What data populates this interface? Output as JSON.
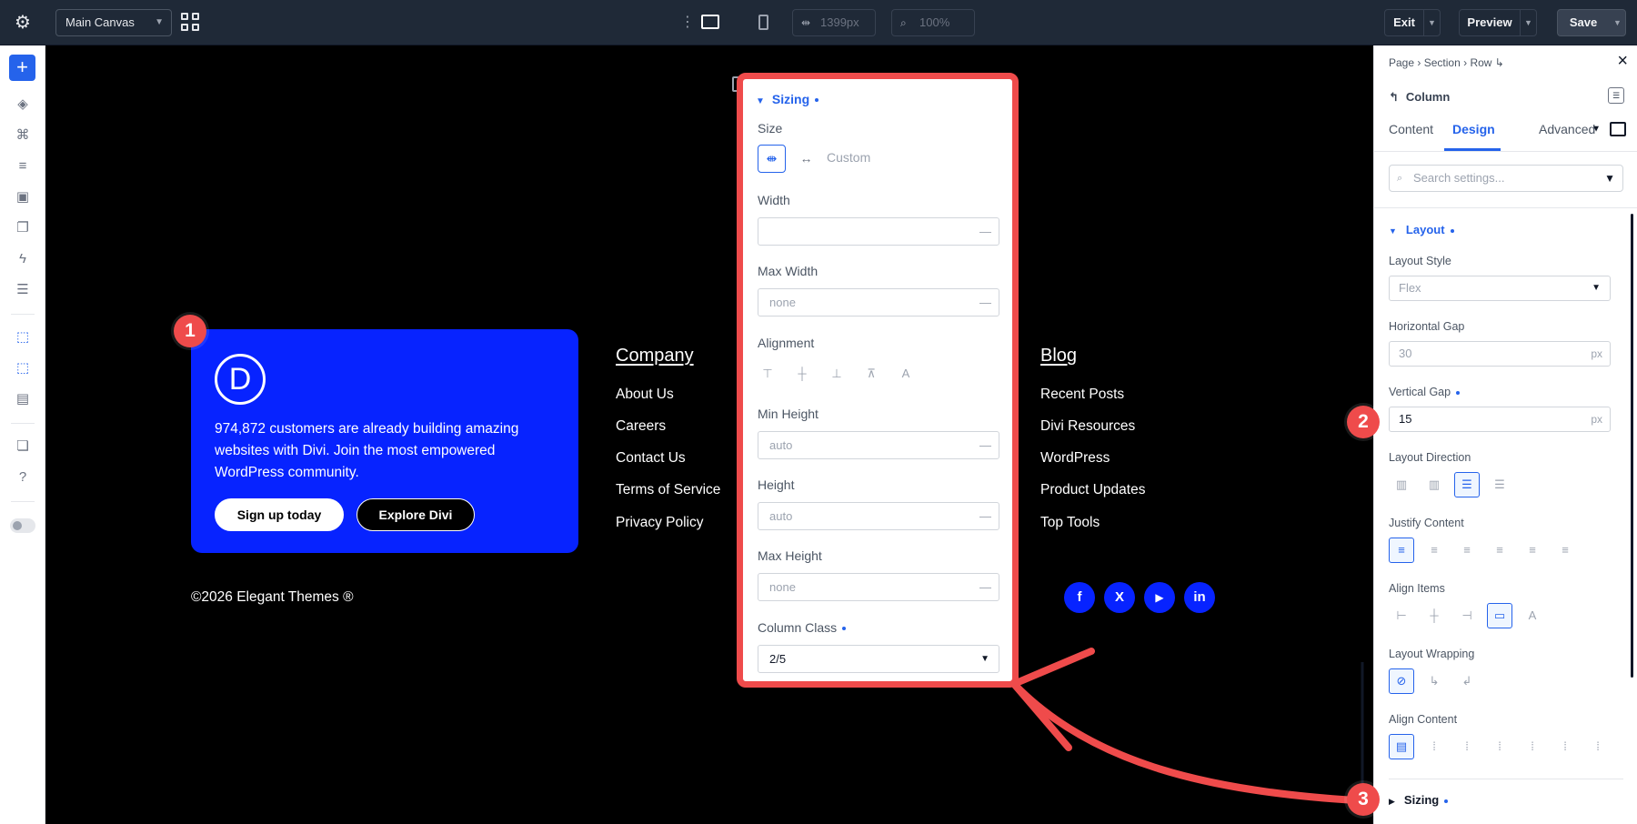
{
  "topbar": {
    "canvas_select": "Main Canvas",
    "width_value": "1399px",
    "zoom_value": "100%",
    "exit_label": "Exit",
    "preview_label": "Preview",
    "save_label": "Save"
  },
  "promo": {
    "logo_letter": "D",
    "text": "974,872 customers are already building amazing websites with Divi. Join the most empowered WordPress community.",
    "signup_label": "Sign up today",
    "explore_label": "Explore Divi"
  },
  "footer": {
    "company_heading": "Company",
    "company_links": [
      "About Us",
      "Careers",
      "Contact Us",
      "Terms of Service",
      "Privacy Policy"
    ],
    "blog_heading": "Blog",
    "blog_links": [
      "Recent Posts",
      "Divi Resources",
      "WordPress",
      "Product Updates",
      "Top Tools"
    ],
    "copyright": "©2026 Elegant Themes ®",
    "social": [
      "f",
      "X",
      "▶",
      "in"
    ]
  },
  "badges": [
    "1",
    "2",
    "3"
  ],
  "sizing_box": {
    "title": "Sizing",
    "size_label": "Size",
    "custom_label": "Custom",
    "width_label": "Width",
    "width_value": "",
    "max_width_label": "Max Width",
    "max_width_value": "none",
    "alignment_label": "Alignment",
    "min_height_label": "Min Height",
    "min_height_value": "auto",
    "height_label": "Height",
    "height_value": "auto",
    "max_height_label": "Max Height",
    "max_height_value": "none",
    "column_class_label": "Column Class",
    "column_class_value": "2/5",
    "dash": "—"
  },
  "right_panel": {
    "breadcrumb": [
      "Page",
      "Section",
      "Row"
    ],
    "module_title": "Column",
    "tabs": [
      "Content",
      "Design",
      "Advanced"
    ],
    "search_placeholder": "Search settings...",
    "layout_heading": "Layout",
    "layout_style_label": "Layout Style",
    "layout_style_value": "Flex",
    "horizontal_gap_label": "Horizontal Gap",
    "horizontal_gap_value": "30",
    "vertical_gap_label": "Vertical Gap",
    "vertical_gap_value": "15",
    "unit": "px",
    "layout_direction_label": "Layout Direction",
    "justify_content_label": "Justify Content",
    "align_items_label": "Align Items",
    "layout_wrapping_label": "Layout Wrapping",
    "align_content_label": "Align Content",
    "sizing_heading": "Sizing"
  },
  "colors": {
    "accent": "#2563eb",
    "annotation": "#ef4b4b",
    "promo_bg": "#0723ff"
  }
}
